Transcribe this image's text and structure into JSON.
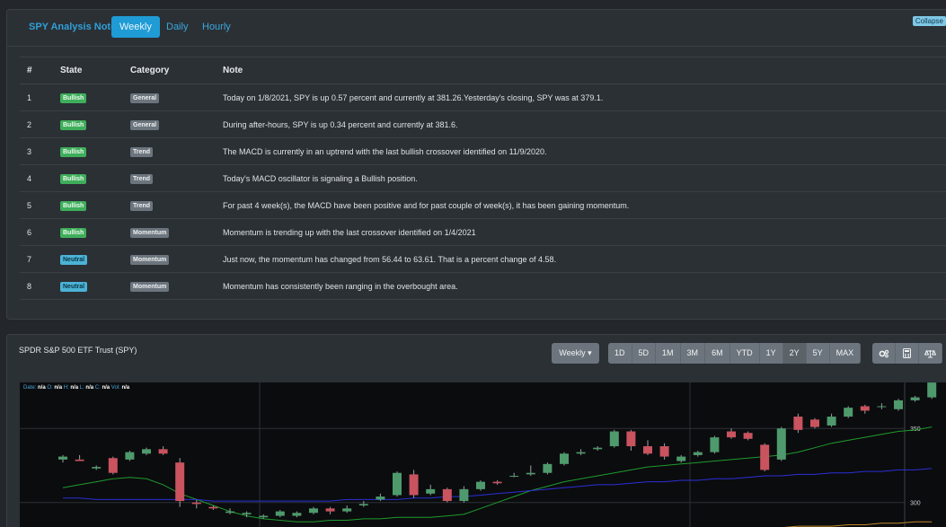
{
  "notes": {
    "title": "SPY Analysis Notes",
    "tabs": [
      "Weekly",
      "Daily",
      "Hourly"
    ],
    "collapse_label": "Collapse",
    "columns": [
      "#",
      "State",
      "Category",
      "Note"
    ],
    "rows": [
      {
        "num": "1",
        "state": "Bullish",
        "category": "General",
        "note": "Today on 1/8/2021, SPY is up 0.57 percent and currently at 381.26.Yesterday's closing, SPY was at 379.1."
      },
      {
        "num": "2",
        "state": "Bullish",
        "category": "General",
        "note": "During after-hours, SPY is up 0.34 percent and currently at 381.6."
      },
      {
        "num": "3",
        "state": "Bullish",
        "category": "Trend",
        "note": "The MACD is currently in an uptrend with the last bullish crossover identified on 11/9/2020."
      },
      {
        "num": "4",
        "state": "Bullish",
        "category": "Trend",
        "note": "Today's MACD oscillator is signaling a Bullish position."
      },
      {
        "num": "5",
        "state": "Bullish",
        "category": "Trend",
        "note": "For past 4 week(s), the MACD have been positive and for past couple of week(s), it has been gaining momentum."
      },
      {
        "num": "6",
        "state": "Bullish",
        "category": "Momentum",
        "note": "Momentum is trending up with the last crossover identified on 1/4/2021"
      },
      {
        "num": "7",
        "state": "Neutral",
        "category": "Momentum",
        "note": "Just now, the momentum has changed from 56.44 to 63.61. That is a percent change of 4.58."
      },
      {
        "num": "8",
        "state": "Neutral",
        "category": "Momentum",
        "note": "Momentum has consistently been ranging in the overbought area."
      }
    ]
  },
  "chart": {
    "title": "SPDR S&P 500 ETF Trust (SPY)",
    "interval_label": "Weekly",
    "ranges": [
      "1D",
      "5D",
      "1M",
      "3M",
      "6M",
      "YTD",
      "1Y",
      "2Y",
      "5Y",
      "MAX"
    ],
    "active_ranges": [
      "2Y"
    ],
    "tools": [
      "settings-icon",
      "calculator-icon",
      "balance-scale-icon"
    ],
    "ohlc": {
      "date_label": "Date:",
      "o_label": "O:",
      "h_label": "H:",
      "l_label": "L:",
      "c_label": "C:",
      "vol_label": "Vol:",
      "value": "n/a"
    },
    "y_ticks": [
      "350",
      "300"
    ]
  },
  "chart_data": {
    "type": "candlestick",
    "y_range": [
      278,
      375
    ],
    "series": [
      {
        "name": "candles",
        "values": [
          [
            329,
            331,
            327,
            332
          ],
          [
            329,
            328,
            332,
            329
          ],
          [
            323,
            324,
            322,
            325
          ],
          [
            330,
            320,
            331,
            319
          ],
          [
            329,
            334,
            328,
            335
          ],
          [
            333,
            336,
            332,
            337
          ],
          [
            336,
            333,
            338,
            332
          ],
          [
            327,
            301,
            330,
            297
          ],
          [
            300,
            299,
            302,
            296
          ],
          [
            297,
            296,
            298,
            295
          ],
          [
            293,
            294,
            292,
            296
          ],
          [
            292,
            293,
            290,
            294
          ],
          [
            290,
            291,
            289,
            292
          ],
          [
            291,
            294,
            290,
            295
          ],
          [
            291,
            293,
            290,
            294
          ],
          [
            293,
            296,
            292,
            297
          ],
          [
            296,
            294,
            297,
            292
          ],
          [
            294,
            296,
            293,
            298
          ],
          [
            298,
            299,
            297,
            301
          ],
          [
            302,
            304,
            301,
            306
          ],
          [
            305,
            320,
            304,
            321
          ],
          [
            319,
            305,
            322,
            303
          ],
          [
            306,
            309,
            305,
            312
          ],
          [
            309,
            301,
            310,
            300
          ],
          [
            301,
            309,
            300,
            311
          ],
          [
            309,
            314,
            308,
            315
          ],
          [
            314,
            313,
            315,
            312
          ],
          [
            318,
            318,
            317,
            320
          ],
          [
            319,
            320,
            318,
            325
          ],
          [
            320,
            326,
            319,
            327
          ],
          [
            326,
            333,
            325,
            334
          ],
          [
            333,
            334,
            332,
            336
          ],
          [
            336,
            337,
            335,
            338
          ],
          [
            338,
            348,
            337,
            349
          ],
          [
            348,
            338,
            349,
            335
          ],
          [
            338,
            333,
            342,
            332
          ],
          [
            338,
            331,
            340,
            329
          ],
          [
            328,
            331,
            327,
            332
          ],
          [
            332,
            334,
            331,
            335
          ],
          [
            334,
            344,
            333,
            345
          ],
          [
            348,
            344,
            350,
            343
          ],
          [
            347,
            343,
            348,
            342
          ],
          [
            339,
            322,
            340,
            321
          ],
          [
            329,
            350,
            328,
            351
          ],
          [
            358,
            349,
            360,
            347
          ],
          [
            356,
            351,
            357,
            350
          ],
          [
            352,
            358,
            351,
            360
          ],
          [
            358,
            364,
            357,
            365
          ],
          [
            365,
            362,
            366,
            360
          ],
          [
            365,
            365,
            363,
            367
          ],
          [
            363,
            369,
            362,
            370
          ],
          [
            369,
            371,
            368,
            372
          ],
          [
            371,
            381,
            370,
            382
          ]
        ]
      },
      {
        "name": "ma-green",
        "values": [
          310,
          312,
          314,
          316,
          317,
          316,
          312,
          306,
          302,
          298,
          294,
          291,
          289,
          288,
          287,
          287,
          288,
          288,
          289,
          289,
          290,
          290,
          290,
          291,
          292,
          296,
          300,
          304,
          308,
          311,
          314,
          316,
          318,
          320,
          322,
          324,
          325,
          326,
          327,
          328,
          329,
          330,
          331,
          332,
          334,
          337,
          340,
          342,
          344,
          346,
          348,
          349,
          351
        ]
      },
      {
        "name": "ma-blue",
        "values": [
          303,
          303,
          302,
          302,
          302,
          302,
          302,
          302,
          302,
          301,
          301,
          301,
          301,
          301,
          301,
          301,
          301,
          302,
          302,
          302,
          302,
          303,
          303,
          304,
          304,
          305,
          306,
          307,
          308,
          309,
          310,
          311,
          312,
          312,
          313,
          314,
          314,
          315,
          315,
          316,
          316,
          317,
          318,
          318,
          319,
          319,
          320,
          320,
          321,
          321,
          322,
          322,
          323
        ]
      },
      {
        "name": "ma-orange",
        "values": [
          270,
          270,
          270,
          271,
          271,
          271,
          271,
          272,
          272,
          272,
          272,
          273,
          273,
          273,
          273,
          274,
          274,
          274,
          274,
          275,
          275,
          276,
          276,
          276,
          277,
          277,
          278,
          278,
          278,
          279,
          279,
          279,
          280,
          280,
          280,
          281,
          281,
          281,
          282,
          282,
          282,
          283,
          283,
          283,
          284,
          284,
          284,
          285,
          285,
          286,
          286,
          287,
          287
        ]
      }
    ]
  },
  "colors": {
    "up": "#4e9a6c",
    "down": "#c9535f",
    "ma_green": "#1f9b2d",
    "ma_blue": "#2b2fd6",
    "ma_orange": "#c08a2b",
    "accent": "#1f9bd5"
  }
}
